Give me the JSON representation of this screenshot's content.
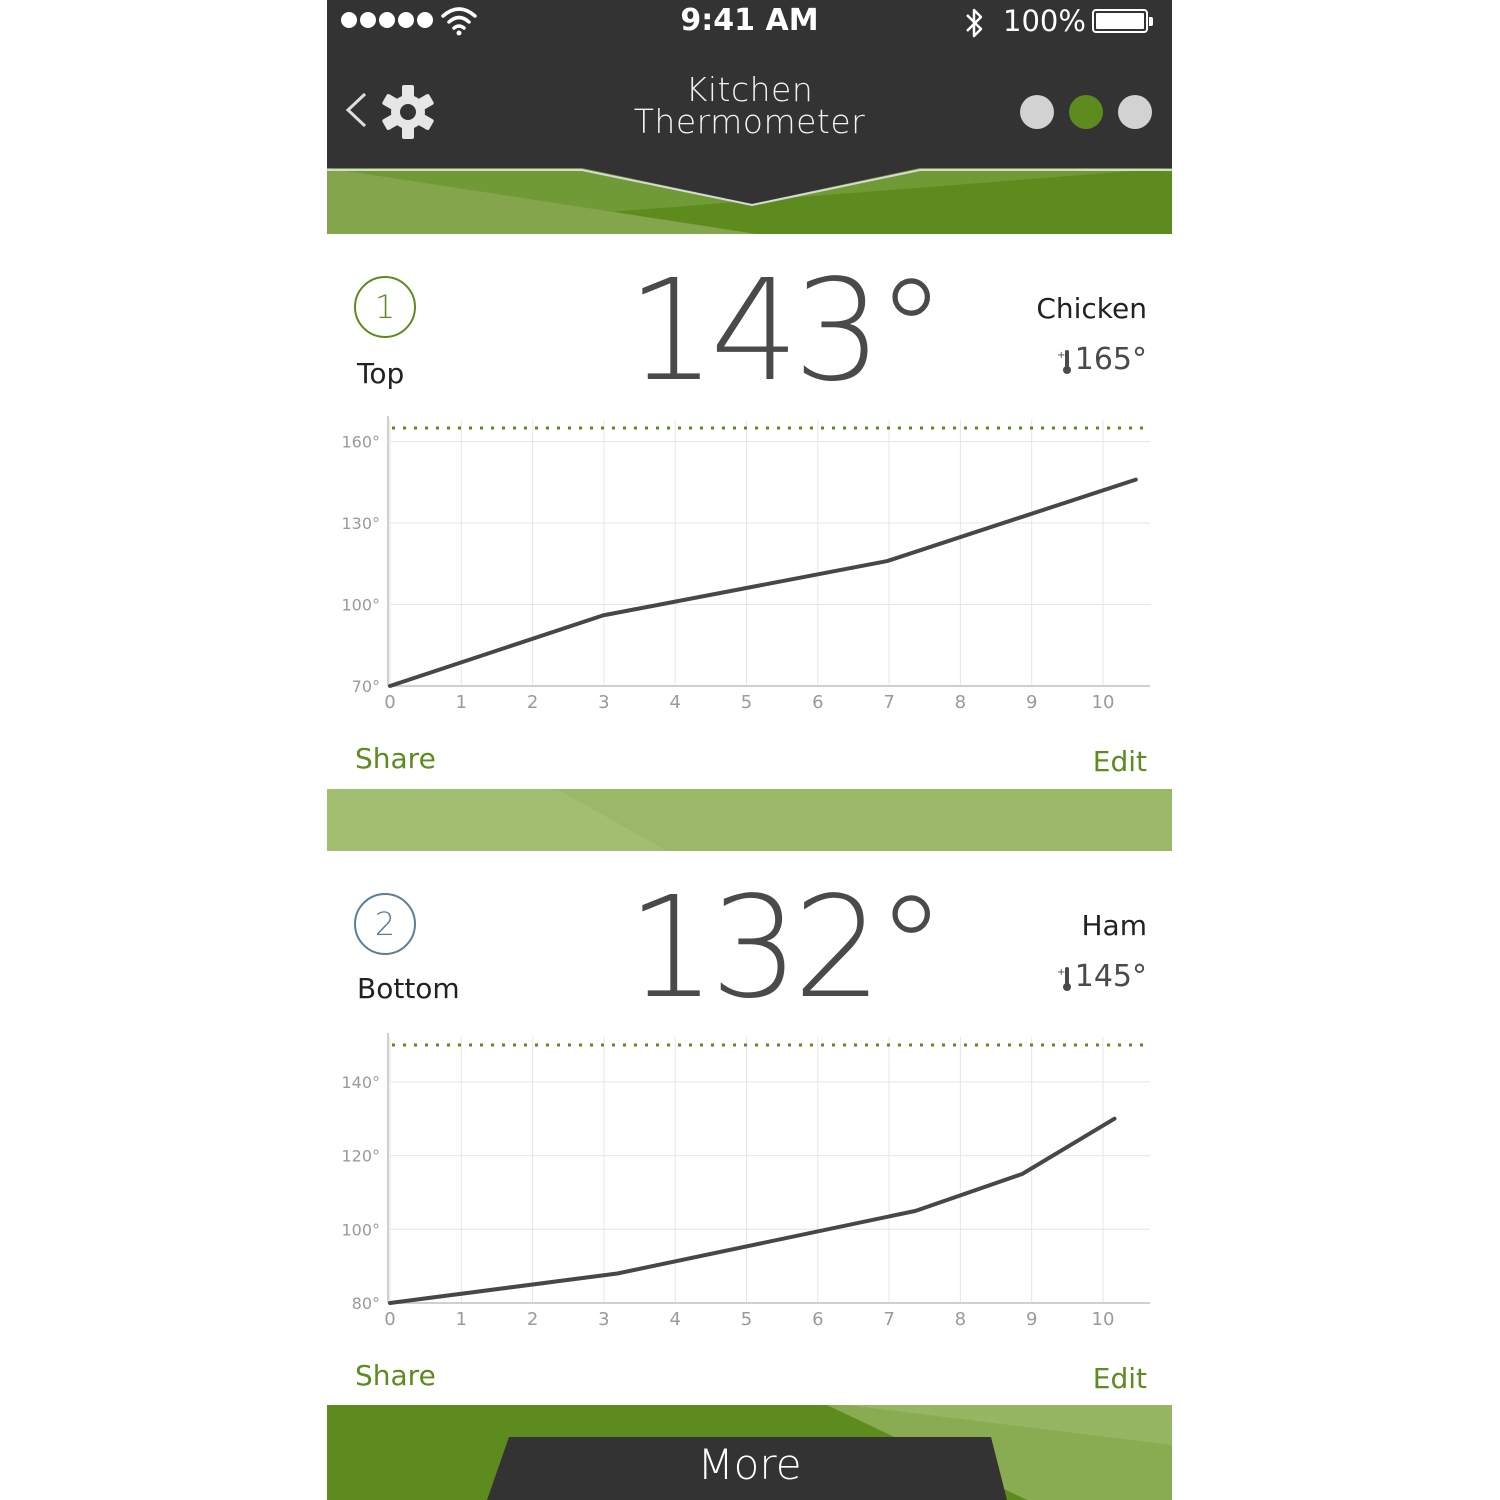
{
  "status_bar": {
    "time": "9:41 AM",
    "battery": "100%",
    "icons": [
      "signal-dots-icon",
      "wifi-icon",
      "bluetooth-icon",
      "battery-icon"
    ]
  },
  "header": {
    "title_line1": "Kitchen",
    "title_line2": "Thermometer",
    "page_dots": 3,
    "active_page": 2,
    "icons": [
      "back-chevron-icon",
      "gear-icon"
    ]
  },
  "colors": {
    "dark_bar": "#333333",
    "accent_green": "#5e8b1e",
    "probe2_blue": "#5b7f95",
    "line": "#474747"
  },
  "probes": [
    {
      "number": "1",
      "name": "Top",
      "current_temp": "143°",
      "food": "Chicken",
      "target_temp": "165°",
      "share_label": "Share",
      "edit_label": "Edit",
      "chart_data": {
        "type": "line",
        "x": [
          0,
          3,
          7,
          10.5
        ],
        "y": [
          70,
          96,
          116,
          146
        ],
        "xticks": [
          "0",
          "1",
          "2",
          "3",
          "4",
          "5",
          "6",
          "7",
          "8",
          "9",
          "10"
        ],
        "yticks": [
          "70°",
          "100°",
          "130°",
          "160°"
        ],
        "ytick_values": [
          70,
          100,
          130,
          160
        ],
        "target_line": 165,
        "xlim": [
          0,
          10.7
        ],
        "ylim": [
          70,
          165
        ]
      }
    },
    {
      "number": "2",
      "name": "Bottom",
      "current_temp": "132°",
      "food": "Ham",
      "target_temp": "145°",
      "share_label": "Share",
      "edit_label": "Edit",
      "chart_data": {
        "type": "line",
        "x": [
          0,
          3.2,
          7.4,
          8.9,
          10.2
        ],
        "y": [
          80,
          88,
          105,
          115,
          130
        ],
        "xticks": [
          "0",
          "1",
          "2",
          "3",
          "4",
          "5",
          "6",
          "7",
          "8",
          "9",
          "10"
        ],
        "yticks": [
          "80°",
          "100°",
          "120°",
          "140°"
        ],
        "ytick_values": [
          80,
          100,
          120,
          140
        ],
        "target_line": 150,
        "xlim": [
          0,
          10.7
        ],
        "ylim": [
          80,
          150
        ]
      }
    }
  ],
  "footer": {
    "more_label": "More"
  }
}
